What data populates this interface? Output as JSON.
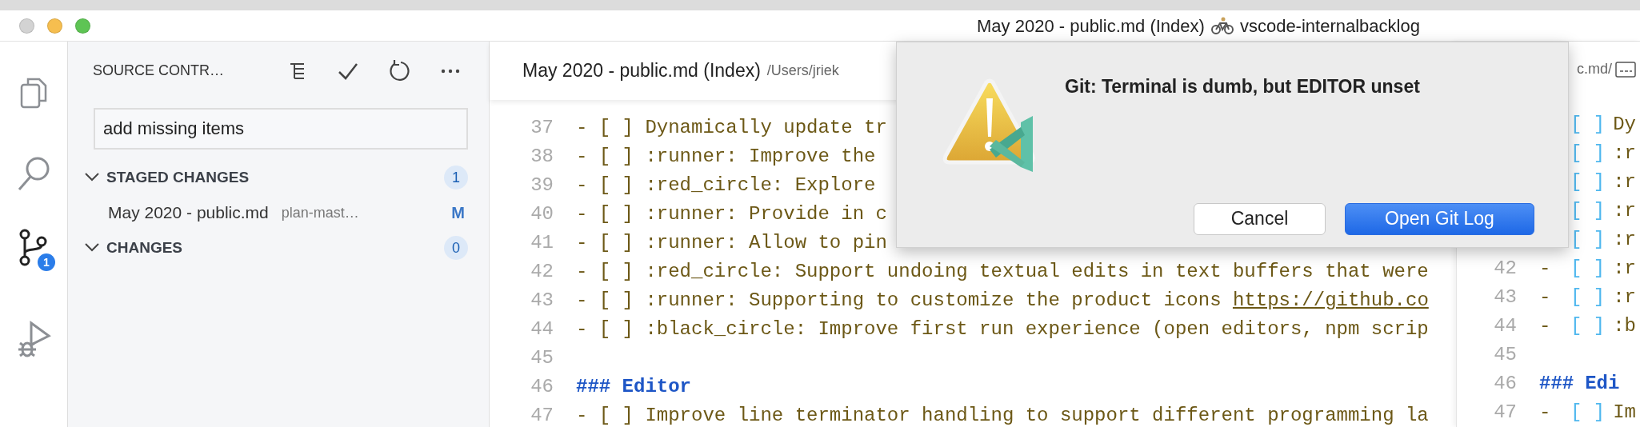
{
  "window": {
    "title": "May 2020 - public.md (Index)",
    "title_suffix": "vscode-internalbacklog"
  },
  "activity_bar": {
    "items": [
      {
        "kind": "explorer",
        "selected": false
      },
      {
        "kind": "search",
        "selected": false
      },
      {
        "kind": "scm",
        "selected": true,
        "badge": "1"
      },
      {
        "kind": "debug",
        "selected": false
      }
    ]
  },
  "sidebar": {
    "title": "SOURCE CONTR…",
    "actions": [
      {
        "kind": "tree"
      },
      {
        "kind": "commit"
      },
      {
        "kind": "refresh"
      },
      {
        "kind": "more"
      }
    ],
    "commit_message": {
      "value": "add missing items"
    },
    "groups": [
      {
        "label": "STAGED CHANGES",
        "count": "1",
        "expanded": true,
        "files": [
          {
            "name": "May 2020 - public.md",
            "description": "plan-mast…",
            "status": "M"
          }
        ]
      },
      {
        "label": "CHANGES",
        "count": "0",
        "expanded": true
      }
    ]
  },
  "editor": {
    "tab": {
      "title": "May 2020 - public.md (Index)",
      "path": "/Users/jriek"
    },
    "lines": [
      {
        "number": "37",
        "kind": "task",
        "text": "- [ ] Dynamically update tr"
      },
      {
        "number": "38",
        "kind": "task",
        "text": "- [ ] :runner: Improve the"
      },
      {
        "number": "39",
        "kind": "task",
        "text": "- [ ] :red_circle: Explore"
      },
      {
        "number": "40",
        "kind": "task",
        "text": "- [ ] :runner: Provide in c"
      },
      {
        "number": "41",
        "kind": "task",
        "text": "- [ ] :runner: Allow to pin"
      },
      {
        "number": "42",
        "kind": "task",
        "text": "- [ ] :red_circle: Support undoing textual edits in text buffers that were"
      },
      {
        "number": "43",
        "kind": "task",
        "text": "- [ ] :runner: Supporting to customize the product icons ",
        "link": "https://github.co"
      },
      {
        "number": "44",
        "kind": "task",
        "text": "- [ ] :black_circle: Improve first run experience (open editors, npm scrip"
      },
      {
        "number": "45",
        "kind": "blank"
      },
      {
        "number": "46",
        "kind": "heading",
        "marker": "###",
        "text": "Editor"
      },
      {
        "number": "47",
        "kind": "task",
        "text": "- [ ] Improve line terminator handling to support different programming la"
      }
    ]
  },
  "side_editor": {
    "tab": {
      "path": "c.md/"
    },
    "lines": [
      {
        "kind": "task",
        "box": "[ ]",
        "text": "Dy"
      },
      {
        "kind": "task",
        "box": "[ ]",
        "text": ":r"
      },
      {
        "kind": "task",
        "box": "[ ]",
        "text": ":r"
      },
      {
        "kind": "task",
        "box": "[ ]",
        "text": ":r"
      },
      {
        "kind": "task",
        "box": "[ ]",
        "text": ":r"
      },
      {
        "number": "42",
        "kind": "task",
        "marker": "-",
        "box": "[ ]",
        "text": ":r"
      },
      {
        "number": "43",
        "kind": "task",
        "marker": "-",
        "box": "[ ]",
        "text": ":r"
      },
      {
        "number": "44",
        "kind": "task",
        "marker": "-",
        "box": "[ ]",
        "text": ":b"
      },
      {
        "number": "45",
        "kind": "blank"
      },
      {
        "number": "46",
        "kind": "heading",
        "marker": "###",
        "text": "Edi"
      },
      {
        "number": "47",
        "kind": "task",
        "marker": "-",
        "box": "[ ]",
        "text": "Im"
      }
    ]
  },
  "dialog": {
    "message": "Git: Terminal is dumb, but EDITOR unset",
    "buttons": [
      {
        "label": "Cancel",
        "primary": false
      },
      {
        "label": "Open Git Log",
        "primary": true
      }
    ]
  }
}
